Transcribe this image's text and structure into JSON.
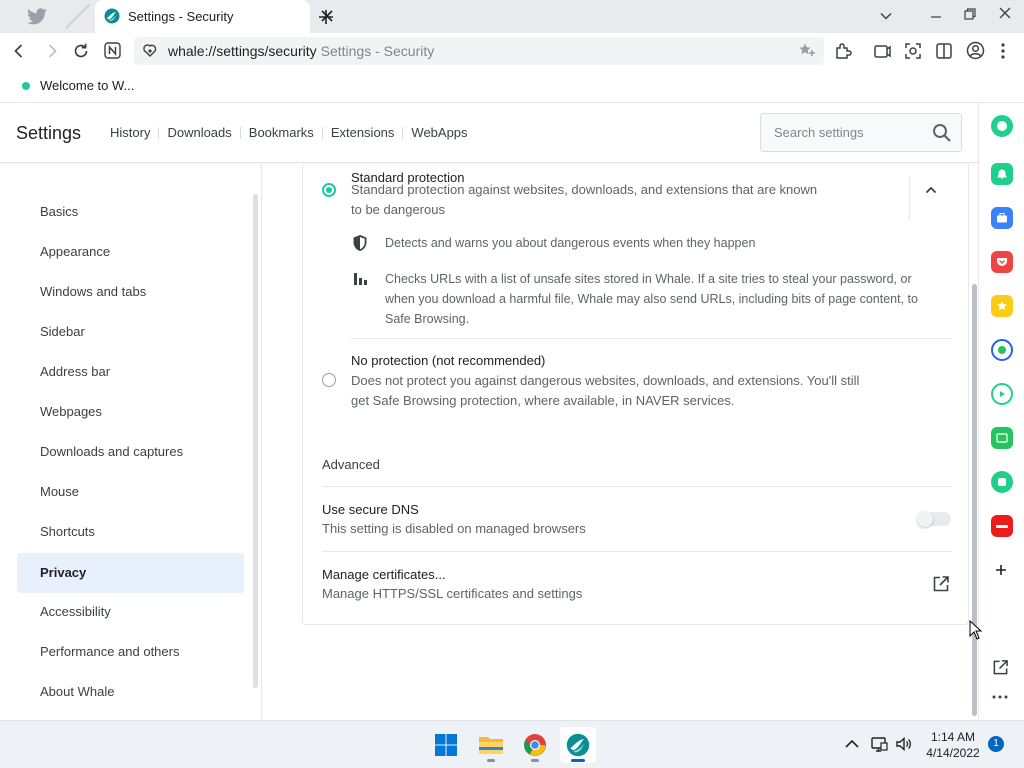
{
  "browser": {
    "tab_title": "Settings - Security",
    "url": "whale://settings/security",
    "url_page_title": "Settings - Security",
    "bookmark_label": "Welcome to W...",
    "accent_color": "#1fc7a4"
  },
  "header": {
    "title": "Settings",
    "nav": [
      "History",
      "Downloads",
      "Bookmarks",
      "Extensions",
      "WebApps"
    ],
    "search_placeholder": "Search settings"
  },
  "sidebar": {
    "items": [
      "Basics",
      "Appearance",
      "Windows and tabs",
      "Sidebar",
      "Address bar",
      "Webpages",
      "Downloads and captures",
      "Mouse",
      "Shortcuts",
      "Privacy",
      "Accessibility",
      "Performance and others",
      "About Whale"
    ],
    "active": "Privacy"
  },
  "main": {
    "standard": {
      "title": "Standard protection",
      "desc": "Standard protection against websites, downloads, and extensions that are known to be dangerous",
      "detail1": "Detects and warns you about dangerous events when they happen",
      "detail2": "Checks URLs with a list of unsafe sites stored in Whale. If a site tries to steal your password, or when you download a harmful file, Whale may also send URLs, including bits of page content, to Safe Browsing."
    },
    "noprotect": {
      "title": "No protection (not recommended)",
      "desc": "Does not protect you against dangerous websites, downloads, and extensions. You'll still get Safe Browsing protection, where available, in NAVER services."
    },
    "advanced_label": "Advanced",
    "dns": {
      "title": "Use secure DNS",
      "desc": "This setting is disabled on managed browsers"
    },
    "certs": {
      "title": "Manage certificates...",
      "desc": "Manage HTTPS/SSL certificates and settings"
    }
  },
  "taskbar": {
    "time": "1:14 AM",
    "date": "4/14/2022",
    "notification_count": "1"
  }
}
